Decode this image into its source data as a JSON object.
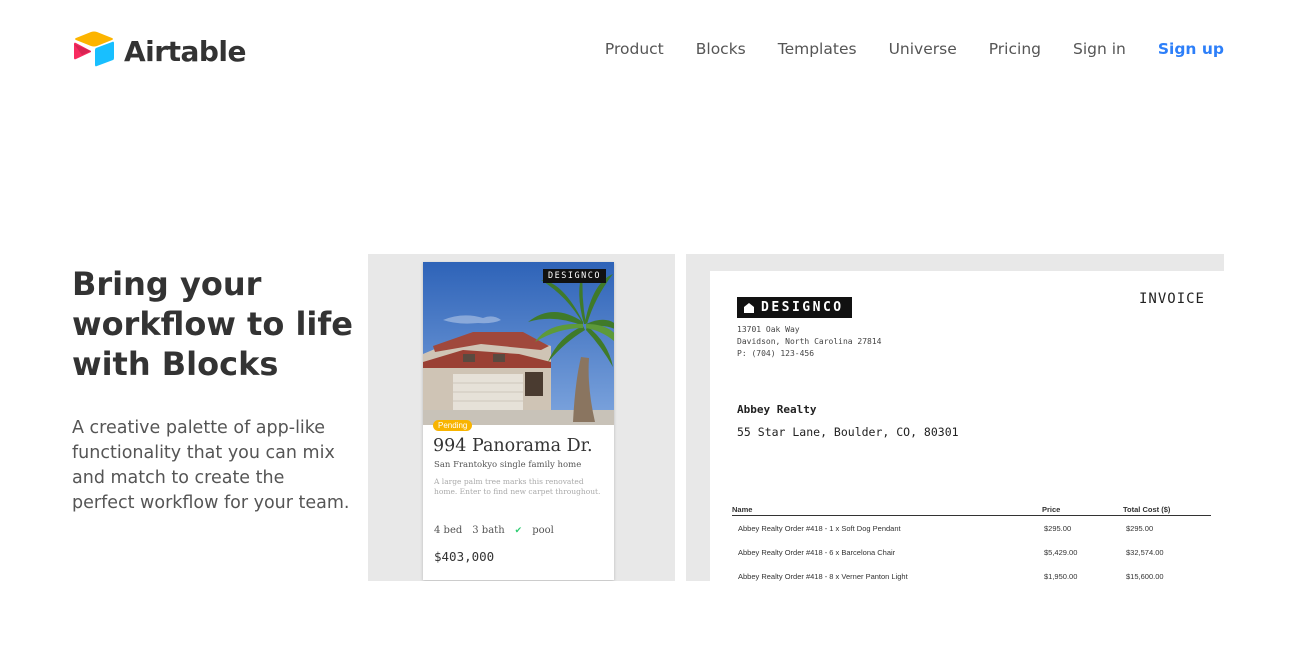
{
  "header": {
    "brand": "Airtable",
    "logo_icon": "airtable-logo-icon",
    "nav": [
      {
        "label": "Product"
      },
      {
        "label": "Blocks"
      },
      {
        "label": "Templates"
      },
      {
        "label": "Universe"
      },
      {
        "label": "Pricing"
      },
      {
        "label": "Sign in"
      },
      {
        "label": "Sign up"
      }
    ],
    "accent_color": "#2d7ff9"
  },
  "hero": {
    "title": "Bring your workflow to life with Blocks",
    "subtitle": "A creative palette of app-like functionality that you can mix and match to create the perfect workflow for your team."
  },
  "property_card": {
    "badge": "DESIGNCO",
    "status": "Pending",
    "title": "994 Panorama Dr.",
    "subtitle": "San Frantokyo single family home",
    "description": "A large palm tree marks this renovated home. Enter to find new carpet throughout.",
    "features": [
      "4 bed",
      "3 bath",
      "pool"
    ],
    "price": "$403,000",
    "status_color": "#f8b400"
  },
  "invoice": {
    "brand": "DESIGNCO",
    "title": "INVOICE",
    "address_lines": [
      "13701 Oak Way",
      "Davidson, North Carolina 27814",
      "P: (704) 123-456"
    ],
    "client_name": "Abbey Realty",
    "client_address": "55 Star Lane, Boulder, CO, 80301",
    "columns": {
      "name": "Name",
      "price": "Price",
      "total": "Total Cost ($)"
    },
    "rows": [
      {
        "name": "Abbey Realty Order #418 - 1 x Soft Dog Pendant",
        "price": "$295.00",
        "total": "$295.00"
      },
      {
        "name": "Abbey Realty Order #418 - 6 x Barcelona Chair",
        "price": "$5,429.00",
        "total": "$32,574.00"
      },
      {
        "name": "Abbey Realty Order #418 - 8 x Verner Panton Light",
        "price": "$1,950.00",
        "total": "$15,600.00"
      }
    ]
  }
}
